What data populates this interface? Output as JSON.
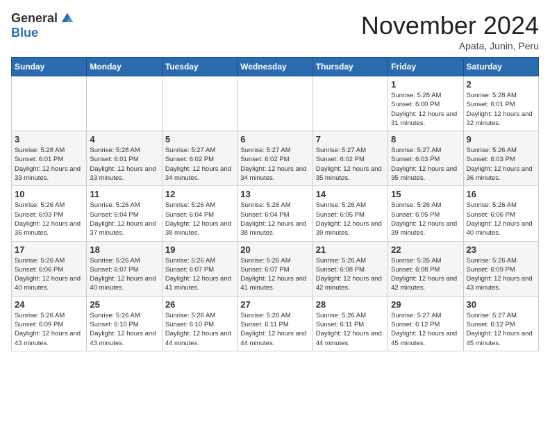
{
  "header": {
    "logo_general": "General",
    "logo_blue": "Blue",
    "month_title": "November 2024",
    "subtitle": "Apata, Junin, Peru"
  },
  "weekdays": [
    "Sunday",
    "Monday",
    "Tuesday",
    "Wednesday",
    "Thursday",
    "Friday",
    "Saturday"
  ],
  "weeks": [
    [
      {
        "day": "",
        "info": ""
      },
      {
        "day": "",
        "info": ""
      },
      {
        "day": "",
        "info": ""
      },
      {
        "day": "",
        "info": ""
      },
      {
        "day": "",
        "info": ""
      },
      {
        "day": "1",
        "info": "Sunrise: 5:28 AM\nSunset: 6:00 PM\nDaylight: 12 hours and 31 minutes."
      },
      {
        "day": "2",
        "info": "Sunrise: 5:28 AM\nSunset: 6:01 PM\nDaylight: 12 hours and 32 minutes."
      }
    ],
    [
      {
        "day": "3",
        "info": "Sunrise: 5:28 AM\nSunset: 6:01 PM\nDaylight: 12 hours and 33 minutes."
      },
      {
        "day": "4",
        "info": "Sunrise: 5:28 AM\nSunset: 6:01 PM\nDaylight: 12 hours and 33 minutes."
      },
      {
        "day": "5",
        "info": "Sunrise: 5:27 AM\nSunset: 6:02 PM\nDaylight: 12 hours and 34 minutes."
      },
      {
        "day": "6",
        "info": "Sunrise: 5:27 AM\nSunset: 6:02 PM\nDaylight: 12 hours and 34 minutes."
      },
      {
        "day": "7",
        "info": "Sunrise: 5:27 AM\nSunset: 6:02 PM\nDaylight: 12 hours and 35 minutes."
      },
      {
        "day": "8",
        "info": "Sunrise: 5:27 AM\nSunset: 6:03 PM\nDaylight: 12 hours and 35 minutes."
      },
      {
        "day": "9",
        "info": "Sunrise: 5:26 AM\nSunset: 6:03 PM\nDaylight: 12 hours and 36 minutes."
      }
    ],
    [
      {
        "day": "10",
        "info": "Sunrise: 5:26 AM\nSunset: 6:03 PM\nDaylight: 12 hours and 36 minutes."
      },
      {
        "day": "11",
        "info": "Sunrise: 5:26 AM\nSunset: 6:04 PM\nDaylight: 12 hours and 37 minutes."
      },
      {
        "day": "12",
        "info": "Sunrise: 5:26 AM\nSunset: 6:04 PM\nDaylight: 12 hours and 38 minutes."
      },
      {
        "day": "13",
        "info": "Sunrise: 5:26 AM\nSunset: 6:04 PM\nDaylight: 12 hours and 38 minutes."
      },
      {
        "day": "14",
        "info": "Sunrise: 5:26 AM\nSunset: 6:05 PM\nDaylight: 12 hours and 39 minutes."
      },
      {
        "day": "15",
        "info": "Sunrise: 5:26 AM\nSunset: 6:05 PM\nDaylight: 12 hours and 39 minutes."
      },
      {
        "day": "16",
        "info": "Sunrise: 5:26 AM\nSunset: 6:06 PM\nDaylight: 12 hours and 40 minutes."
      }
    ],
    [
      {
        "day": "17",
        "info": "Sunrise: 5:26 AM\nSunset: 6:06 PM\nDaylight: 12 hours and 40 minutes."
      },
      {
        "day": "18",
        "info": "Sunrise: 5:26 AM\nSunset: 6:07 PM\nDaylight: 12 hours and 40 minutes."
      },
      {
        "day": "19",
        "info": "Sunrise: 5:26 AM\nSunset: 6:07 PM\nDaylight: 12 hours and 41 minutes."
      },
      {
        "day": "20",
        "info": "Sunrise: 5:26 AM\nSunset: 6:07 PM\nDaylight: 12 hours and 41 minutes."
      },
      {
        "day": "21",
        "info": "Sunrise: 5:26 AM\nSunset: 6:08 PM\nDaylight: 12 hours and 42 minutes."
      },
      {
        "day": "22",
        "info": "Sunrise: 5:26 AM\nSunset: 6:08 PM\nDaylight: 12 hours and 42 minutes."
      },
      {
        "day": "23",
        "info": "Sunrise: 5:26 AM\nSunset: 6:09 PM\nDaylight: 12 hours and 43 minutes."
      }
    ],
    [
      {
        "day": "24",
        "info": "Sunrise: 5:26 AM\nSunset: 6:09 PM\nDaylight: 12 hours and 43 minutes."
      },
      {
        "day": "25",
        "info": "Sunrise: 5:26 AM\nSunset: 6:10 PM\nDaylight: 12 hours and 43 minutes."
      },
      {
        "day": "26",
        "info": "Sunrise: 5:26 AM\nSunset: 6:10 PM\nDaylight: 12 hours and 44 minutes."
      },
      {
        "day": "27",
        "info": "Sunrise: 5:26 AM\nSunset: 6:11 PM\nDaylight: 12 hours and 44 minutes."
      },
      {
        "day": "28",
        "info": "Sunrise: 5:26 AM\nSunset: 6:11 PM\nDaylight: 12 hours and 44 minutes."
      },
      {
        "day": "29",
        "info": "Sunrise: 5:27 AM\nSunset: 6:12 PM\nDaylight: 12 hours and 45 minutes."
      },
      {
        "day": "30",
        "info": "Sunrise: 5:27 AM\nSunset: 6:12 PM\nDaylight: 12 hours and 45 minutes."
      }
    ]
  ]
}
